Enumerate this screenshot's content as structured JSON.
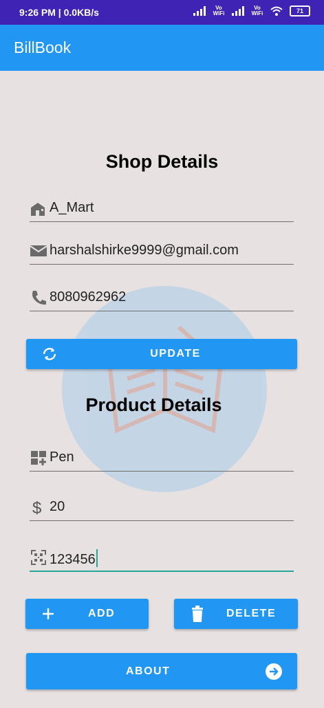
{
  "status_bar": {
    "time": "9:26 PM | 0.0KB/s",
    "vowifi1": "Vo WiFi",
    "vowifi2": "Vo WiFi",
    "battery": "71"
  },
  "app_bar": {
    "title": "BillBook"
  },
  "shop": {
    "heading": "Shop Details",
    "name": "A_Mart",
    "email": "harshalshirke9999@gmail.com",
    "phone": "8080962962",
    "update_label": "UPDATE"
  },
  "product": {
    "heading": "Product Details",
    "name": "Pen",
    "price": "20",
    "code": "123456"
  },
  "actions": {
    "add_label": "ADD",
    "delete_label": "DELETE",
    "about_label": "ABOUT"
  },
  "colors": {
    "primary": "#2196f3",
    "status_bar": "#3f23b4",
    "background": "#e7e1e1",
    "focus": "#26a69a"
  },
  "icons": [
    "home-icon",
    "mail-icon",
    "phone-icon",
    "sync-icon",
    "dashboard-icon",
    "dollar-icon",
    "qr-code-icon",
    "plus-icon",
    "trash-icon",
    "arrow-right-circle-icon",
    "bill-book-watermark-icon"
  ]
}
